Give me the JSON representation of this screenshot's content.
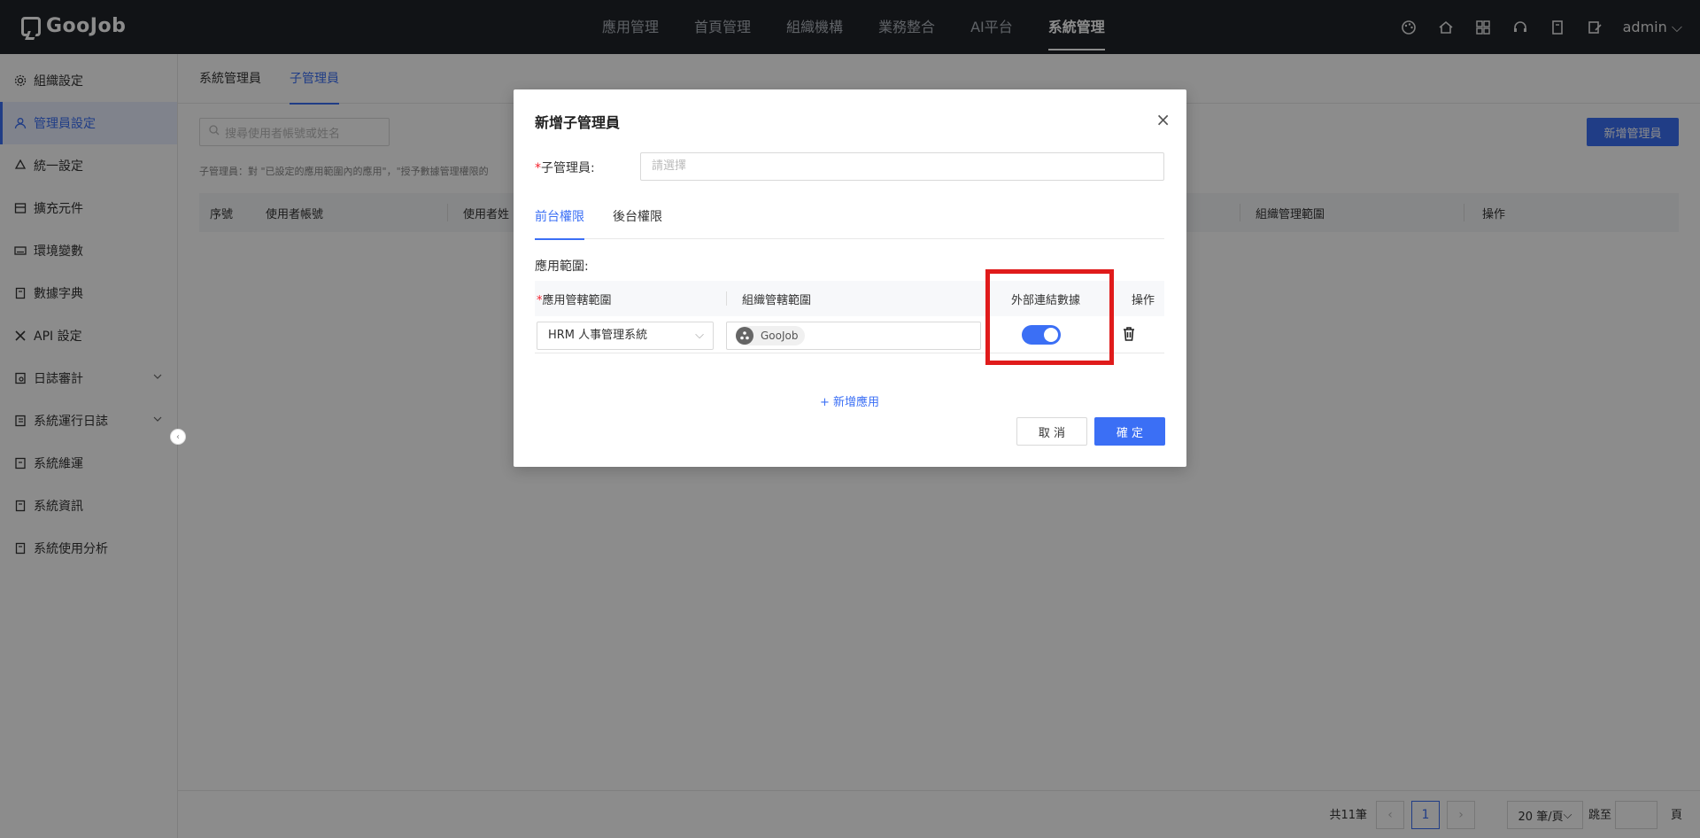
{
  "app": {
    "logo_text": "GooJob",
    "nav": [
      "應用管理",
      "首頁管理",
      "組織機構",
      "業務整合",
      "AI平台",
      "系統管理"
    ],
    "active_nav": 5,
    "user": "admin"
  },
  "sidebar": {
    "items": [
      {
        "label": "組織設定",
        "icon": "gear-icon"
      },
      {
        "label": "管理員設定",
        "icon": "user-icon"
      },
      {
        "label": "統一設定",
        "icon": "recycle-icon"
      },
      {
        "label": "擴充元件",
        "icon": "box-icon"
      },
      {
        "label": "環境變數",
        "icon": "keyboard-icon"
      },
      {
        "label": "數據字典",
        "icon": "book-icon"
      },
      {
        "label": "API 設定",
        "icon": "tools-icon"
      },
      {
        "label": "日誌審計",
        "icon": "audit-icon"
      },
      {
        "label": "系統運行日誌",
        "icon": "log-icon"
      },
      {
        "label": "系統維運",
        "icon": "maintenance-icon"
      },
      {
        "label": "系統資訊",
        "icon": "info-icon"
      },
      {
        "label": "系統使用分析",
        "icon": "analysis-icon"
      }
    ]
  },
  "main": {
    "tabs": [
      "系統管理員",
      "子管理員"
    ],
    "search_placeholder": "搜尋使用者帳號或姓名",
    "add_button": "新增管理員",
    "hint": "子管理員：對 \"已設定的應用範圍內的應用\"，\"授予數據管理權限的",
    "columns": [
      "序號",
      "使用者帳號",
      "使用者姓",
      "組織管理範圍",
      "操作"
    ],
    "pager": {
      "total": "共11筆",
      "current_page": "1",
      "page_size": "20 筆/頁",
      "goto": "跳至",
      "page_unit": "頁"
    }
  },
  "modal": {
    "title": "新增子管理員",
    "close": "×",
    "field_label": "子管理員:",
    "field_placeholder": "請選擇",
    "tabs": [
      "前台權限",
      "後台權限"
    ],
    "scope_label": "應用範圍:",
    "columns": [
      "應用管轄範圍",
      "組織管轄範圍",
      "外部連結數據",
      "操作"
    ],
    "row": {
      "app": "HRM 人事管理系統",
      "org_tag": "GooJob",
      "external_link_enabled": true
    },
    "add_app": "+ 新增應用",
    "cancel": "取 消",
    "ok": "確 定"
  }
}
